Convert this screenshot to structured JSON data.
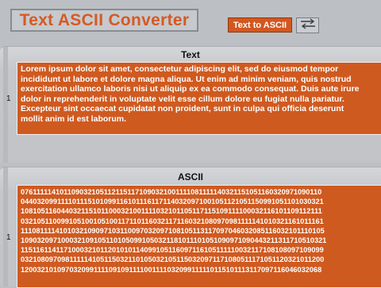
{
  "app": {
    "title": "Text ASCII Converter",
    "mode_button_label": "Text to ASCII",
    "swap_icon": "swap-arrows-icon",
    "accent_color": "#d3571f"
  },
  "text_panel": {
    "label": "Text",
    "row_number": "1",
    "lines": [
      "Lorem ipsum dolor sit amet, consectetur adipiscing elit, sed do eiusmod tempor",
      "incididunt ut labore et dolore magna aliqua. Ut enim ad minim veniam, quis nostrud",
      "exercitation ullamco laboris nisi ut aliquip ex ea commodo consequat. Duis aute irure",
      "dolor in reprehenderit in voluptate velit esse cillum dolore eu fugiat nulla pariatur.",
      "Excepteur sint occaecat cupidatat non proident, sunt in culpa qui officia deserunt",
      "mollit anim id est laborum."
    ]
  },
  "ascii_panel": {
    "label": "ASCII",
    "row_number": "1",
    "lines": [
      "0761111141011090321051121151171090321001111081111140321151051160320971090110",
      "0440320991111011151010991161011161171140320971001051121051150991051101030321",
      "1081051160440321151011000321001111032101105117115109111100032116101109112111",
      "0321051100991051001051001171101160321171160321080970981111141010321161011161",
      "1110811114101032109097103110097032097108105113117097046032085116032101110105",
      "1090320971000321091051101050991050321181011101051090971090443211311710510321",
      "1151161141171000321011201010114099105116097116105111110032117108108097109099",
      "0321080970981111141051150321101050321051150320971171080511171051120321011200",
      "1200321010970320991111091091111001111032099111110115101113117097116046032068"
    ]
  }
}
